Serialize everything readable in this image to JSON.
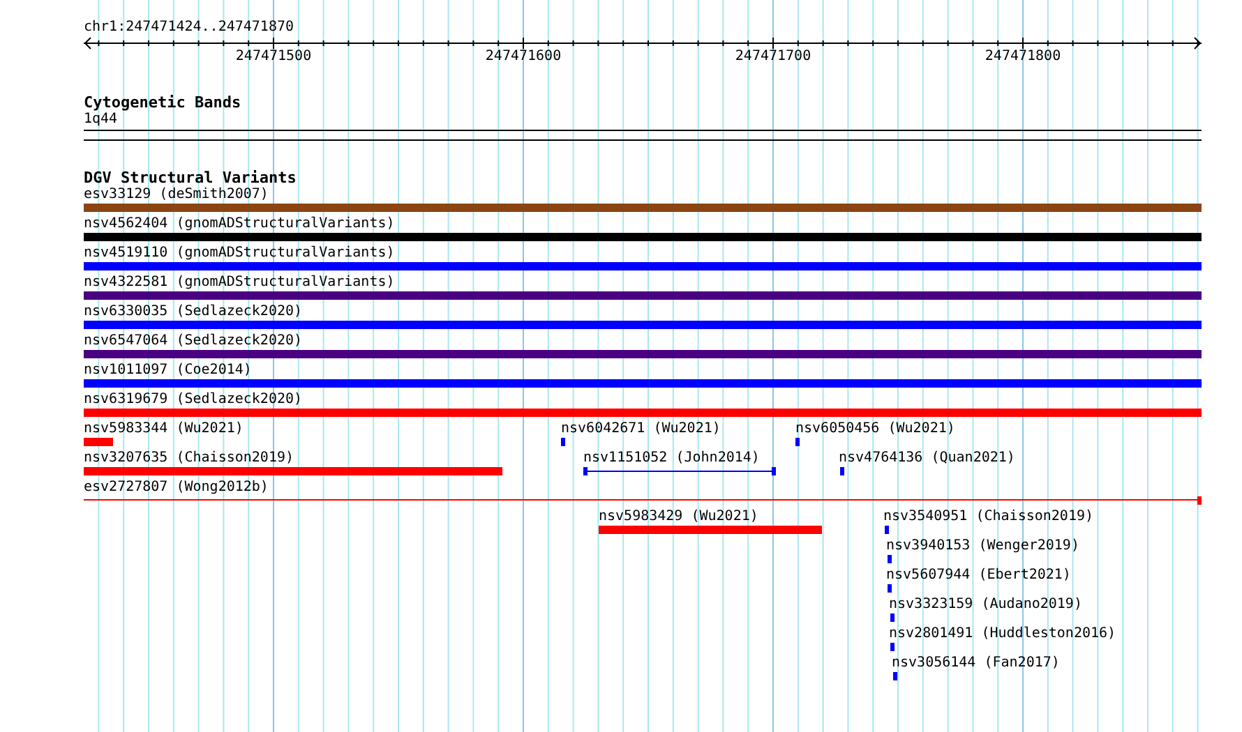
{
  "location": "chr1:247471424..247471870",
  "ruler": {
    "tick_labels": [
      "247471500",
      "247471600",
      "247471700",
      "247471800"
    ]
  },
  "band_track": {
    "title": "Cytogenetic Bands",
    "band": {
      "label": "1q44"
    }
  },
  "variant_track": {
    "title": "DGV Structural Variants",
    "features": [
      {
        "label": "esv33129 (deSmith2007)",
        "color": "#8b4513",
        "kind": "bar"
      },
      {
        "label": "nsv4562404 (gnomADStructuralVariants)",
        "color": "#000000",
        "kind": "bar"
      },
      {
        "label": "nsv4519110 (gnomADStructuralVariants)",
        "color": "#0000ff",
        "kind": "bar"
      },
      {
        "label": "nsv4322581 (gnomADStructuralVariants)",
        "color": "#4b0082",
        "kind": "bar"
      },
      {
        "label": "nsv6330035 (Sedlazeck2020)",
        "color": "#0000ff",
        "kind": "bar"
      },
      {
        "label": "nsv6547064 (Sedlazeck2020)",
        "color": "#4b0082",
        "kind": "bar"
      },
      {
        "label": "nsv1011097 (Coe2014)",
        "color": "#0000ff",
        "kind": "bar"
      },
      {
        "label": "nsv6319679 (Sedlazeck2020)",
        "color": "#ff0000",
        "kind": "bar"
      },
      {
        "label": "nsv5983344 (Wu2021)",
        "color": "#ff0000",
        "kind": "bar"
      },
      {
        "label": "nsv6042671 (Wu2021)",
        "color": "#0000ff",
        "kind": "bar"
      },
      {
        "label": "nsv6050456 (Wu2021)",
        "color": "#0000ff",
        "kind": "bar"
      },
      {
        "label": "nsv3207635 (Chaisson2019)",
        "color": "#ff0000",
        "kind": "bar"
      },
      {
        "label": "nsv1151052 (John2014)",
        "color": "#0000ff",
        "kind": "span"
      },
      {
        "label": "nsv4764136 (Quan2021)",
        "color": "#0000ff",
        "kind": "bar"
      },
      {
        "label": "esv2727807 (Wong2012b)",
        "color": "#ff0000",
        "kind": "line"
      },
      {
        "label": "nsv5983429 (Wu2021)",
        "color": "#ff0000",
        "kind": "bar"
      },
      {
        "label": "nsv3540951 (Chaisson2019)",
        "color": "#0000ff",
        "kind": "bar"
      },
      {
        "label": "nsv3940153 (Wenger2019)",
        "color": "#0000ff",
        "kind": "bar"
      },
      {
        "label": "nsv5607944 (Ebert2021)",
        "color": "#0000ff",
        "kind": "bar"
      },
      {
        "label": "nsv3323159 (Audano2019)",
        "color": "#0000ff",
        "kind": "bar"
      },
      {
        "label": "nsv2801491 (Huddleston2016)",
        "color": "#0000ff",
        "kind": "bar"
      },
      {
        "label": "nsv3056144 (Fan2017)",
        "color": "#0000ff",
        "kind": "bar"
      }
    ]
  }
}
